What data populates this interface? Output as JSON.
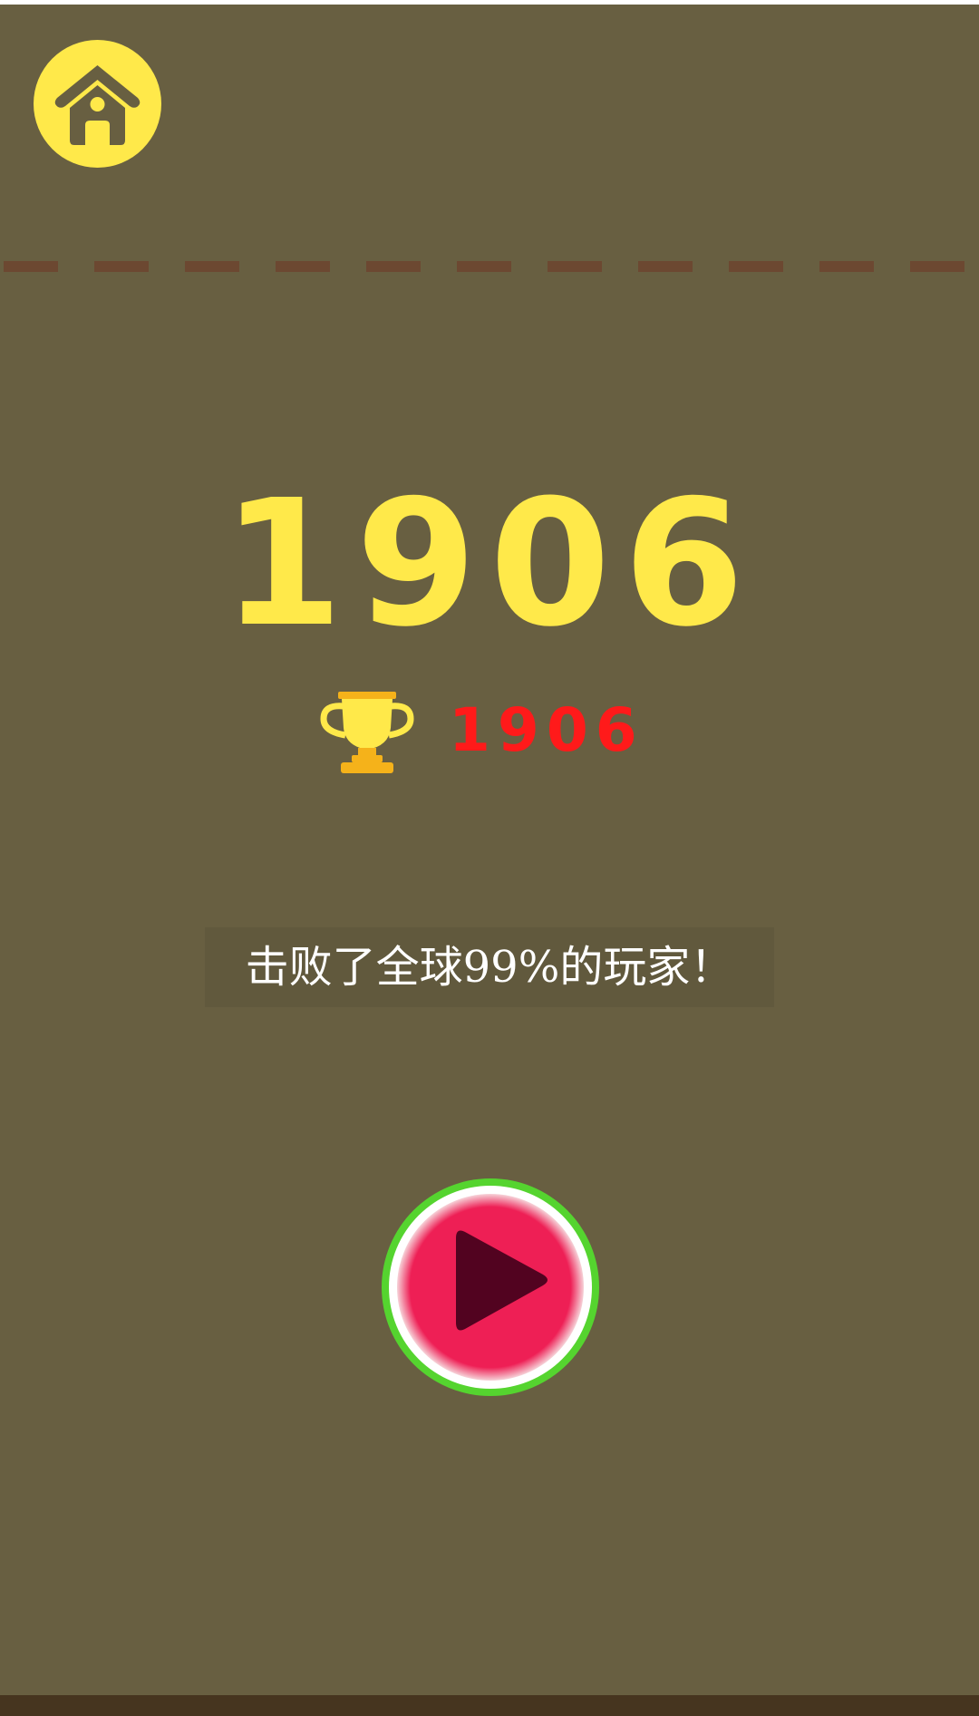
{
  "screen": {
    "title": "",
    "background_color": "#685f41",
    "accent_color": "#ffe94a"
  },
  "home_button": {
    "icon": "home-icon",
    "color": "#ffe94a"
  },
  "deadline": {
    "color": "#6c4831"
  },
  "score": {
    "value": "1906",
    "color": "#ffe94a"
  },
  "best": {
    "icon": "trophy-icon",
    "value": "1906",
    "color": "#ff1a1a"
  },
  "message": {
    "text": "击败了全球99%的玩家！"
  },
  "play_button": {
    "icon": "play-icon",
    "ring_color": "#55d42f",
    "fill_color": "#ee1f55",
    "triangle_color": "#520320"
  }
}
